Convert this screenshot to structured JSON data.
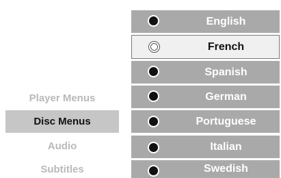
{
  "menu": {
    "items": [
      {
        "label": "Player Menus",
        "active": false
      },
      {
        "label": "Disc Menus",
        "active": true
      },
      {
        "label": "Audio",
        "active": false
      },
      {
        "label": "Subtitles",
        "active": false
      }
    ]
  },
  "languages": {
    "selected": "French",
    "items": [
      {
        "label": "English"
      },
      {
        "label": "French"
      },
      {
        "label": "Spanish"
      },
      {
        "label": "German"
      },
      {
        "label": "Portuguese"
      },
      {
        "label": "Italian"
      },
      {
        "label": "Swedish"
      }
    ]
  },
  "colors": {
    "row_bg": "#a9a9a9",
    "selected_row_bg": "#f0f0f0",
    "active_menu_bg": "#c6c6c6",
    "inactive_text": "#b9b9b9"
  }
}
